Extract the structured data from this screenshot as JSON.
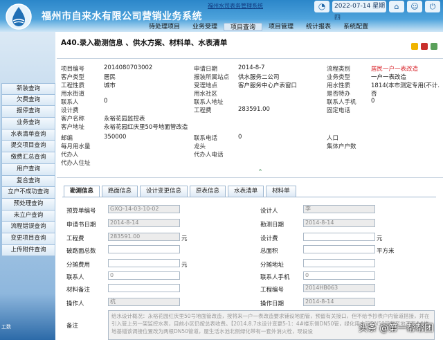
{
  "header": {
    "title": "福州市自来水有限公司营销业务系统",
    "link": "福州水司表务管理系统",
    "clock_icon": "clock-icon",
    "datetime": "2022-07-14 星期四",
    "nav": [
      "待处理项目",
      "业务受理",
      "项目查询",
      "项目管理",
      "统计报表",
      "系统配置"
    ],
    "nav_active": 2
  },
  "sidebar": {
    "items": [
      "新装查询",
      "欠费查询",
      "报停查询",
      "业务查询",
      "水表清单查询",
      "提交项目查询",
      "缴费汇总查询",
      "用户查询",
      "复合查询",
      "立户不成功查询",
      "预处理查询",
      "未立户查询",
      "流程错误查询",
      "变更项目查询",
      "上传附件查询"
    ],
    "footer": "工数"
  },
  "main": {
    "page_title": "A40.录入勘测信息 、供水方案、材料单、水表清单"
  },
  "info": [
    {
      "l1": "项目编号",
      "v1": "2014080703002",
      "l2": "申请日期",
      "v2": "2014-8-7",
      "l3": "流程类别",
      "v3": "居民一户一表改造",
      "v3_red": true
    },
    {
      "l1": "客户类型",
      "v1": "居民",
      "l2": "报装所属站点",
      "v2": "供水服务二公司",
      "l3": "业务类型",
      "v3": "一户一表改造"
    },
    {
      "l1": "工程性质",
      "v1": "城市",
      "l2": "受理地点",
      "v2": "客户服务中心户表窗口",
      "l3": "用水性质",
      "v3": "1814(本市测定专用(不计…"
    },
    {
      "l1": "用水街道",
      "v1": "",
      "l2": "用水社区",
      "v2": "",
      "l3": "是否特办",
      "v3": "否"
    },
    {
      "l1": "联系人",
      "v1": "0",
      "l2": "联系人地址",
      "v2": "",
      "l3": "联系人手机",
      "v3": "0"
    },
    {
      "l1": "设计费",
      "v1": "",
      "l2": "工程费",
      "v2": "283591.00",
      "l3": "固定电话",
      "v3": ""
    },
    {
      "l1": "客户名称",
      "v1": "永裕花园监控表",
      "l2": "",
      "v2": "",
      "l3": "",
      "v3": ""
    },
    {
      "l1": "客户地址",
      "v1": "永裕花园红庆里50号地面管改造",
      "l2": "",
      "v2": "",
      "l3": "",
      "v3": ""
    },
    {
      "l1": "邮编",
      "v1": "350000",
      "l2": "联系电话",
      "v2": "0",
      "l3": "人口",
      "v3": ""
    },
    {
      "l1": "每月用水量",
      "v1": "",
      "l2": "龙头",
      "v2": "",
      "l3": "集体户户数",
      "v3": ""
    },
    {
      "l1": "代办人",
      "v1": "",
      "l2": "代办人电话",
      "v2": "",
      "l3": "",
      "v3": ""
    },
    {
      "l1": "代办人住址",
      "v1": "",
      "l2": "",
      "v2": "",
      "l3": "",
      "v3": ""
    }
  ],
  "tabs": [
    "勘测信息",
    "路面信息",
    "设计变更信息",
    "原表信息",
    "水表清单",
    "材料单"
  ],
  "form": {
    "budget_no_label": "预算单编号",
    "budget_no": "GXQ-14-03-10-02",
    "designer_label": "设计人",
    "designer": "李",
    "apply_date_label": "申请书日期",
    "apply_date": "2014-8-14",
    "survey_date_label": "勘测日期",
    "survey_date": "2014-8-14",
    "eng_fee_label": "工程费",
    "eng_fee": "283591.00",
    "design_fee_label": "设计费",
    "design_fee": "",
    "unit_yuan": "元",
    "road_area_label": "破路面总数",
    "road_area": "",
    "total_area_label": "总面积",
    "total_area": "",
    "unit_sqm": "平方米",
    "split_fee_label": "分摊费用",
    "split_fee": "",
    "split_addr_label": "分摊地址",
    "split_addr": "",
    "contact_label": "联系人",
    "contact": "0",
    "contact_mobile_label": "联系人手机",
    "contact_mobile": "0",
    "material_note_label": "材料备注",
    "material_note": "",
    "project_no_label": "工程编号",
    "project_no": "2014HB063",
    "operator_label": "操作人",
    "operator": "杭",
    "op_date_label": "操作日期",
    "op_date": "2014-8-14",
    "note_label": "备注",
    "note": "给水设计概况：永裕花园红庆里50号地面管改造，按将来一户一表改造要求铺设地面管，预留有关接口，但不给予抄表户内管道搭接，并在引入管上另一架监控水表，目前小区仍按总表收费。【2014.8.7水设计变更5-1：4#楼东侧DN50管，绿化用水管DN50管截至地下有4#楼地基锚该调接位置改为两根DN50管道，屋生活水池北侧绿化带有一套外消火栓，现设设"
  },
  "watermark": "头条 @第一帮帮团"
}
